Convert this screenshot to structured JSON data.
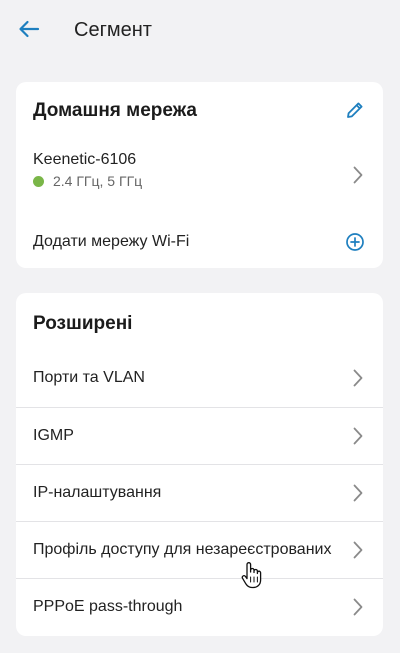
{
  "header": {
    "title": "Сегмент",
    "back_icon": "arrow-left-icon"
  },
  "home_network": {
    "title": "Домашня мережа",
    "edit_icon": "pencil-icon",
    "network": {
      "name": "Keenetic-6106",
      "bands": "2.4 ГГц, 5 ГГц",
      "status_color": "#7ab648"
    },
    "add_wifi_label": "Додати мережу Wi-Fi",
    "add_icon": "plus-circle-icon"
  },
  "advanced": {
    "title": "Розширені",
    "items": [
      {
        "label": "Порти та VLAN"
      },
      {
        "label": "IGMP"
      },
      {
        "label": "IP-налаштування"
      },
      {
        "label": "Профіль доступу для незареєстрованих"
      },
      {
        "label": "PPPoE pass-through"
      }
    ]
  },
  "colors": {
    "accent": "#1e7fbf",
    "background": "#f2f2f4",
    "card": "#ffffff",
    "chevron": "#8a8a8a"
  }
}
